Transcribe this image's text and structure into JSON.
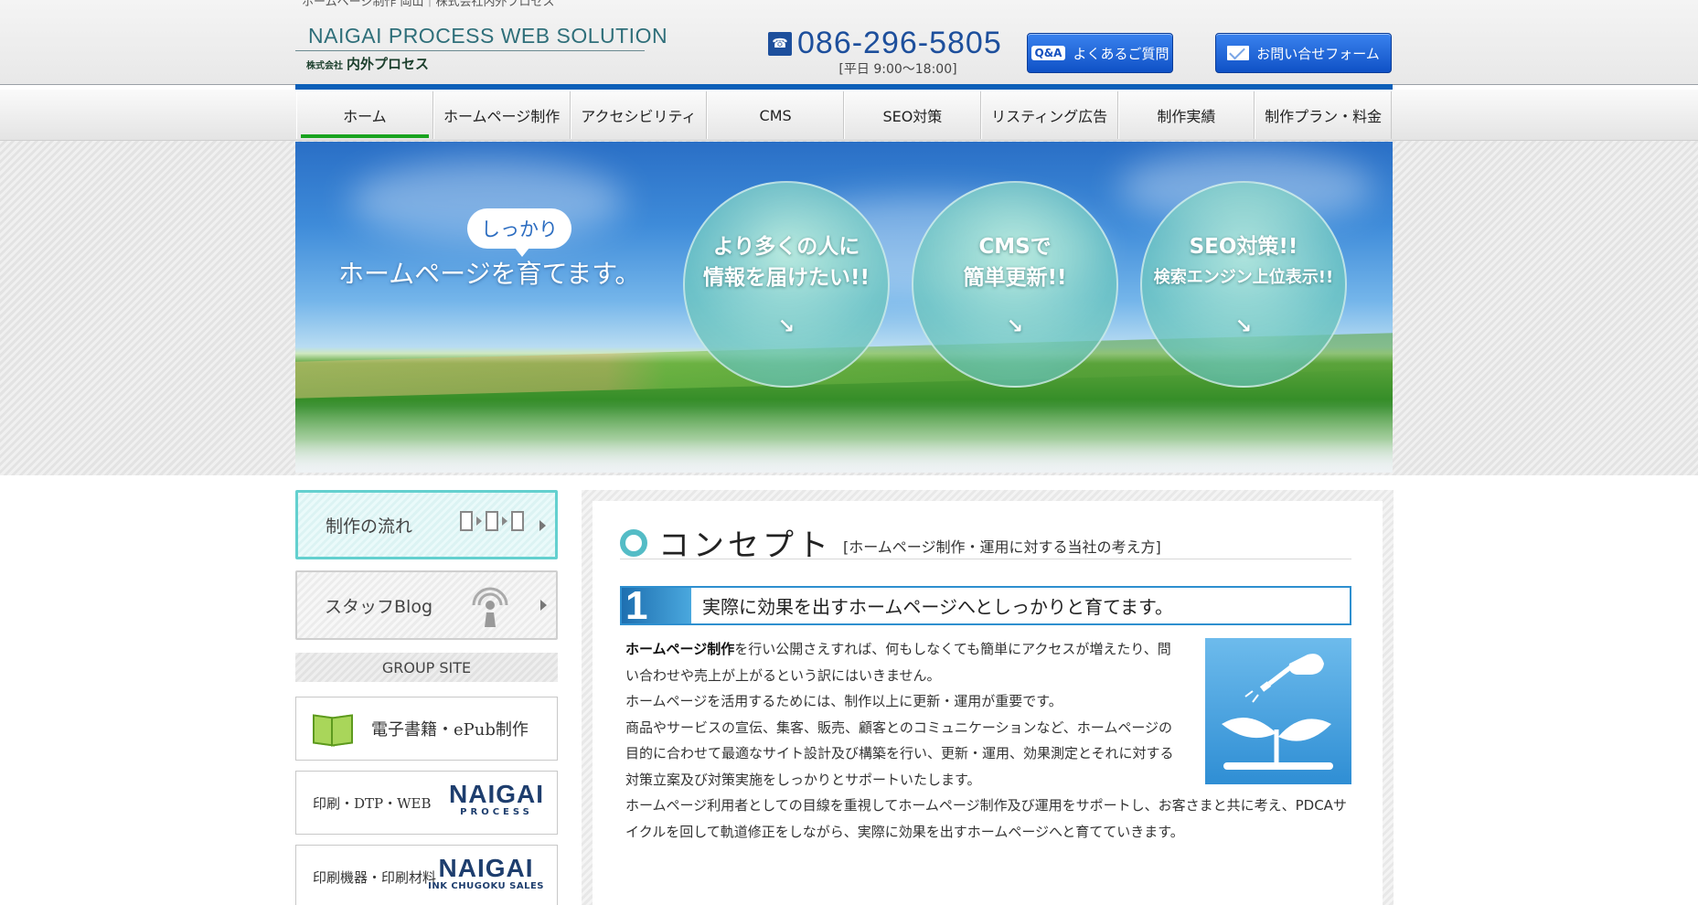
{
  "header": {
    "tagline": "ホームページ制作 岡山｜株式会社内外プロセス",
    "logo_en": "NAIGAI PROCESS WEB SOLUTION",
    "logo_jp_prefix": "株式会社",
    "logo_jp_name": "内外プロセス",
    "phone": "086-296-5805",
    "hours": "[平日 9:00〜18:00]",
    "faq_badge": "Q&A",
    "faq_label": "よくあるご質問",
    "contact_label": "お問い合せフォーム"
  },
  "nav": {
    "items": [
      {
        "label": "ホーム"
      },
      {
        "label": "ホームページ制作"
      },
      {
        "label": "アクセシビリティ"
      },
      {
        "label": "CMS"
      },
      {
        "label": "SEO対策"
      },
      {
        "label": "リスティング広告"
      },
      {
        "label": "制作実績"
      },
      {
        "label": "制作プラン・料金"
      }
    ]
  },
  "hero": {
    "bubble": "しっかり",
    "title": "ホームページを育てます。",
    "circles": [
      {
        "line1": "より多くの人に",
        "line2": "情報を届けたい!!",
        "arrow": "↘"
      },
      {
        "line1": "CMSで",
        "line2": "簡単更新!!",
        "arrow": "↘"
      },
      {
        "line1": "SEO対策!!",
        "line2": "検索エンジン上位表示!!",
        "arrow": "↘"
      }
    ]
  },
  "sidebar": {
    "flow_label": "制作の流れ",
    "blog_label": "スタッフBlog",
    "group_heading": "GROUP SITE",
    "ebook_label": "電子書籍・ePub制作",
    "print_label": "印刷・DTP・WEB",
    "print_brand": "NAIGAI",
    "print_brand_sub": "PROCESS",
    "ink_label": "印刷機器・印刷材料",
    "ink_brand": "NAIGAI",
    "ink_brand_sub": "INK CHUGOKU SALES"
  },
  "content": {
    "title": "コンセプト",
    "subtitle": "[ホームページ制作・運用に対する当社の考え方]",
    "point_num": "1",
    "point_text": "実際に効果を出すホームページへとしっかりと育てます。",
    "p1_bold": "ホームページ制作",
    "p1_rest": "を行い公開さえすれば、何もしなくても簡単にアクセスが増えたり、問い合わせや売上が上がるという訳にはいきません。",
    "p2": "ホームページを活用するためには、制作以上に更新・運用が重要です。",
    "p3": "商品やサービスの宣伝、集客、販売、顧客とのコミュニケーションなど、ホームページの目的に合わせて最適なサイト設計及び構築を行い、更新・運用、効果測定とそれに対する対策立案及び対策実施をしっかりとサポートいたします。",
    "p4": "ホームページ利用者としての目線を重視してホームページ制作及び運用をサポートし、お客さまと共に考え、PDCAサイクルを回して軌道修正をしながら、実際に効果を出すホームページへと育てていきます。"
  }
}
